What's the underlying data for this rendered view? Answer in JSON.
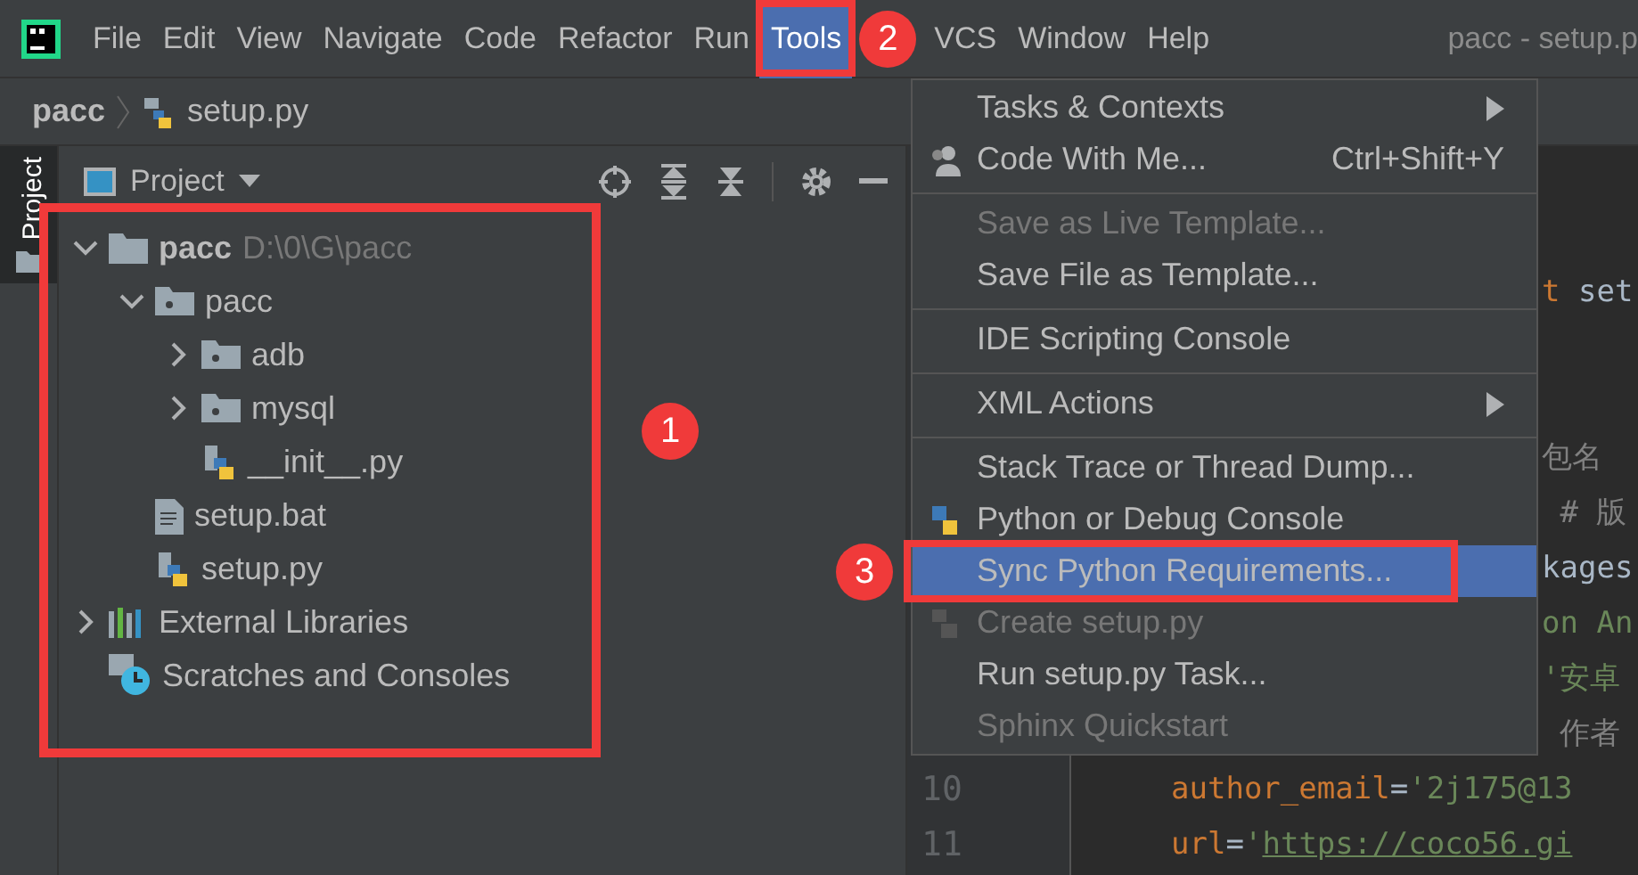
{
  "menubar": {
    "items": [
      {
        "label": "File",
        "selected": false
      },
      {
        "label": "Edit",
        "selected": false
      },
      {
        "label": "View",
        "selected": false
      },
      {
        "label": "Navigate",
        "selected": false
      },
      {
        "label": "Code",
        "selected": false
      },
      {
        "label": "Refactor",
        "selected": false
      },
      {
        "label": "Run",
        "selected": false
      },
      {
        "label": "Tools",
        "selected": true
      },
      {
        "label": "VCS",
        "selected": false
      },
      {
        "label": "Window",
        "selected": false
      },
      {
        "label": "Help",
        "selected": false
      }
    ],
    "title": "pacc - setup.p"
  },
  "breadcrumb": [
    "pacc",
    "setup.py"
  ],
  "project_panel": {
    "title": "Project",
    "tree": [
      {
        "label": "pacc",
        "path": "D:\\0\\G\\pacc",
        "kind": "root",
        "expanded": true,
        "children": [
          {
            "label": "pacc",
            "kind": "package",
            "expanded": true,
            "children": [
              {
                "label": "adb",
                "kind": "package",
                "expanded": false
              },
              {
                "label": "mysql",
                "kind": "package",
                "expanded": false
              },
              {
                "label": "__init__.py",
                "kind": "python"
              }
            ]
          },
          {
            "label": "setup.bat",
            "kind": "text"
          },
          {
            "label": "setup.py",
            "kind": "python"
          }
        ]
      },
      {
        "label": "External Libraries",
        "kind": "libraries",
        "expanded": false
      },
      {
        "label": "Scratches and Consoles",
        "kind": "scratches"
      }
    ]
  },
  "side_tab": {
    "label": "Project",
    "selected": true
  },
  "tools_menu": [
    {
      "kind": "item",
      "label": "Tasks & Contexts",
      "submenu": true,
      "disabled": false,
      "selected": false
    },
    {
      "kind": "people",
      "label": "Code With Me...",
      "shortcut": "Ctrl+Shift+Y",
      "submenu": false,
      "disabled": false,
      "selected": false
    },
    {
      "kind": "separator"
    },
    {
      "kind": "item",
      "label": "Save as Live Template...",
      "submenu": false,
      "disabled": true,
      "selected": false
    },
    {
      "kind": "item",
      "label": "Save File as Template...",
      "submenu": false,
      "disabled": false,
      "selected": false
    },
    {
      "kind": "separator"
    },
    {
      "kind": "item",
      "label": "IDE Scripting Console",
      "submenu": false,
      "disabled": false,
      "selected": false
    },
    {
      "kind": "separator"
    },
    {
      "kind": "item",
      "label": "XML Actions",
      "submenu": true,
      "disabled": false,
      "selected": false
    },
    {
      "kind": "separator"
    },
    {
      "kind": "item",
      "label": "Stack Trace or Thread Dump...",
      "submenu": false,
      "disabled": false,
      "selected": false
    },
    {
      "kind": "python",
      "label": "Python or Debug Console",
      "submenu": false,
      "disabled": false,
      "selected": false
    },
    {
      "kind": "item",
      "label": "Sync Python Requirements...",
      "submenu": false,
      "disabled": false,
      "selected": true
    },
    {
      "kind": "python",
      "label": "Create setup.py",
      "submenu": false,
      "disabled": true,
      "selected": false
    },
    {
      "kind": "item",
      "label": "Run setup.py Task...",
      "submenu": false,
      "disabled": false,
      "selected": false
    },
    {
      "kind": "item",
      "label": "Sphinx Quickstart",
      "submenu": false,
      "disabled": true,
      "selected": false
    }
  ],
  "editor": {
    "lines": [
      {
        "segments": [
          {
            "kind": "keyword",
            "text": "t"
          },
          {
            "kind": "plain",
            "text": " set"
          }
        ]
      },
      {
        "segments": [
          {
            "kind": "comment",
            "text": "包名"
          }
        ]
      },
      {
        "segments": [
          {
            "kind": "comment",
            "text": " # 版"
          }
        ]
      },
      {
        "segments": [
          {
            "kind": "plain",
            "text": "kages"
          }
        ]
      },
      {
        "segments": [
          {
            "kind": "string",
            "text": "on An"
          }
        ]
      },
      {
        "segments": [
          {
            "kind": "string",
            "text": "'安卓"
          }
        ]
      },
      {
        "segments": [
          {
            "kind": "comment",
            "text": " 作者"
          }
        ]
      },
      {
        "number": "10",
        "segments": [
          {
            "kind": "keyword",
            "text": "author_email"
          },
          {
            "kind": "plain",
            "text": "="
          },
          {
            "kind": "string",
            "text": "'2j175@13"
          }
        ]
      },
      {
        "number": "11",
        "segments": [
          {
            "kind": "keyword",
            "text": "url"
          },
          {
            "kind": "plain",
            "text": "="
          },
          {
            "kind": "string",
            "text": "'"
          },
          {
            "kind": "link",
            "text": "https://coco56.gi"
          }
        ]
      }
    ]
  },
  "annotations": [
    {
      "number": "1"
    },
    {
      "number": "2"
    },
    {
      "number": "3"
    }
  ]
}
